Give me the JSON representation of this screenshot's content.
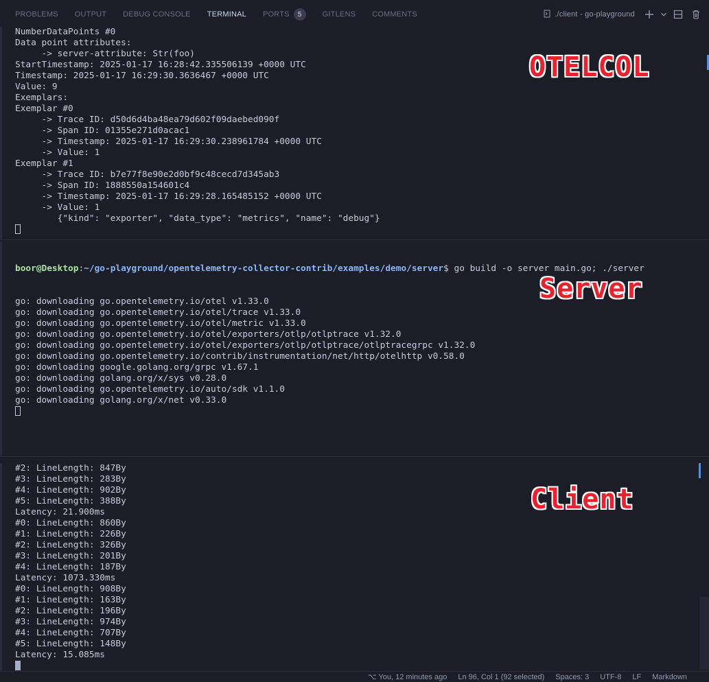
{
  "panel": {
    "tabs": [
      {
        "label": "Problems"
      },
      {
        "label": "Output"
      },
      {
        "label": "Debug Console"
      },
      {
        "label": "Terminal"
      },
      {
        "label": "Ports",
        "badge": "5"
      },
      {
        "label": "GitLens"
      },
      {
        "label": "Comments"
      }
    ],
    "terminal_name": "./client - go-playground"
  },
  "otelcol": {
    "label": "OTELCOL",
    "lines": [
      "NumberDataPoints #0",
      "Data point attributes:",
      "     -> server-attribute: Str(foo)",
      "StartTimestamp: 2025-01-17 16:28:42.335506139 +0000 UTC",
      "Timestamp: 2025-01-17 16:29:30.3636467 +0000 UTC",
      "Value: 9",
      "Exemplars:",
      "Exemplar #0",
      "     -> Trace ID: d50d6d4ba48ea79d602f09daebed090f",
      "     -> Span ID: 01355e271d0acac1",
      "     -> Timestamp: 2025-01-17 16:29:30.238961784 +0000 UTC",
      "     -> Value: 1",
      "Exemplar #1",
      "     -> Trace ID: b7e77f8e90e2d0bf9c48cecd7d345ab3",
      "     -> Span ID: 1888550a154601c4",
      "     -> Timestamp: 2025-01-17 16:29:28.165485152 +0000 UTC",
      "     -> Value: 1",
      "        {\"kind\": \"exporter\", \"data_type\": \"metrics\", \"name\": \"debug\"}"
    ]
  },
  "server": {
    "label": "Server",
    "prompt_user": "boor@Desktop",
    "prompt_path": "~/go-playground/opentelemetry-collector-contrib/examples/demo/server",
    "command": "$ go build -o server main.go; ./server",
    "lines": [
      "go: downloading go.opentelemetry.io/otel v1.33.0",
      "go: downloading go.opentelemetry.io/otel/trace v1.33.0",
      "go: downloading go.opentelemetry.io/otel/metric v1.33.0",
      "go: downloading go.opentelemetry.io/otel/exporters/otlp/otlptrace v1.32.0",
      "go: downloading go.opentelemetry.io/otel/exporters/otlp/otlptrace/otlptracegrpc v1.32.0",
      "go: downloading go.opentelemetry.io/contrib/instrumentation/net/http/otelhttp v0.58.0",
      "go: downloading google.golang.org/grpc v1.67.1",
      "go: downloading golang.org/x/sys v0.28.0",
      "go: downloading go.opentelemetry.io/auto/sdk v1.1.0",
      "go: downloading golang.org/x/net v0.33.0"
    ]
  },
  "client": {
    "label": "Client",
    "lines": [
      "#2: LineLength: 847By",
      "#3: LineLength: 283By",
      "#4: LineLength: 902By",
      "#5: LineLength: 388By",
      "Latency: 21.900ms",
      "#0: LineLength: 860By",
      "#1: LineLength: 226By",
      "#2: LineLength: 326By",
      "#3: LineLength: 201By",
      "#4: LineLength: 187By",
      "Latency: 1073.330ms",
      "#0: LineLength: 908By",
      "#1: LineLength: 163By",
      "#2: LineLength: 196By",
      "#3: LineLength: 974By",
      "#4: LineLength: 707By",
      "#5: LineLength: 148By",
      "Latency: 15.085ms"
    ]
  },
  "status_bar": {
    "blame": "You, 12 minutes ago",
    "cursor": "Ln 96, Col 1 (92 selected)",
    "spaces": "Spaces: 3",
    "encoding": "UTF-8",
    "eol": "LF",
    "language": "Markdown"
  },
  "icons": {
    "terminal": "terminal-icon",
    "add": "plus-icon",
    "dropdown": "chevron-down-icon",
    "split": "split-icon",
    "trash": "trash-icon",
    "git": "git-icon"
  },
  "colors": {
    "background": "#1b1d27",
    "text": "#c6cadb",
    "prompt_user": "#a6e3a1",
    "prompt_path": "#89b4fa",
    "label": "#e8232f"
  }
}
